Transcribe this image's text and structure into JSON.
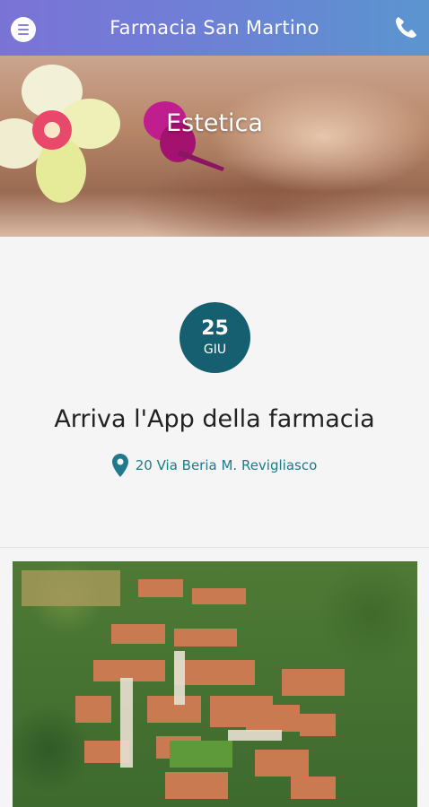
{
  "header": {
    "title": "Farmacia San Martino",
    "menu_icon": "menu-icon",
    "phone_icon": "phone-icon",
    "bg_colors": [
      "#7a73d6",
      "#5a95cf"
    ]
  },
  "hero": {
    "title": "Estetica"
  },
  "event": {
    "day": "25",
    "month": "GIU",
    "title": "Arriva l'App della farmacia",
    "address": "20 Via Beria M. Revigliasco",
    "location_icon": "map-pin-icon",
    "badge_color": "#155f70",
    "accent_color": "#1f7a8c"
  },
  "gallery": {
    "image": "aerial-town-photo"
  }
}
